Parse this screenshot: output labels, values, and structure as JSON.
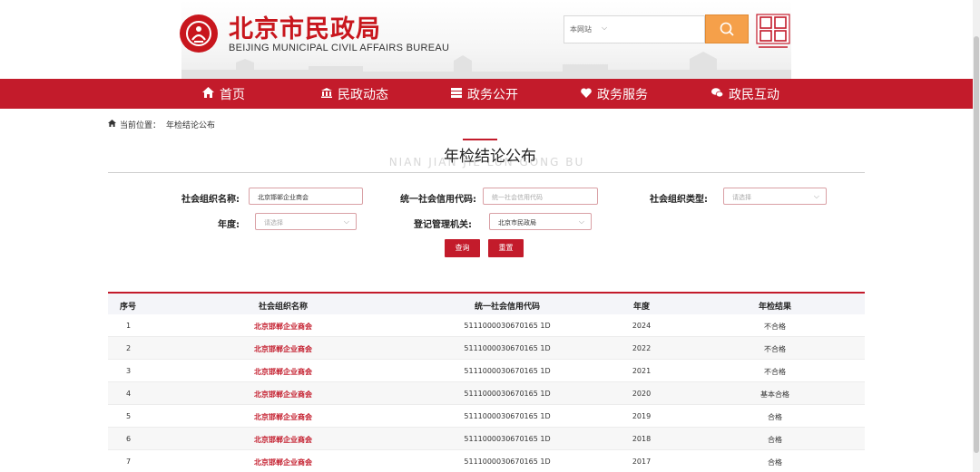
{
  "header": {
    "title_cn": "北京市民政局",
    "title_en": "BEIJING MUNICIPAL CIVIL AFFAIRS BUREAU",
    "search_scope": "本网站",
    "capital_logo_icon": "beijing-capital-logo"
  },
  "nav": {
    "items": [
      {
        "label": "首页",
        "icon": "home-icon"
      },
      {
        "label": "民政动态",
        "icon": "building-icon"
      },
      {
        "label": "政务公开",
        "icon": "list-icon"
      },
      {
        "label": "政务服务",
        "icon": "heart-icon"
      },
      {
        "label": "政民互动",
        "icon": "chat-icon"
      }
    ]
  },
  "breadcrumb": {
    "prefix": "当前位置：",
    "current": "年检结论公布"
  },
  "page": {
    "title": "年检结论公布",
    "title_en": "NIAN JIAN JIE LUN GONG BU"
  },
  "form": {
    "org_name_label": "社会组织名称:",
    "org_name_value": "北京邯郸企业商会",
    "credit_code_label": "统一社会信用代码:",
    "credit_code_placeholder": "统一社会信用代码",
    "org_type_label": "社会组织类型:",
    "org_type_placeholder": "请选择",
    "year_label": "年度:",
    "year_placeholder": "请选择",
    "registry_label": "登记管理机关:",
    "registry_value": "北京市民政局",
    "query_button": "查询",
    "reset_button": "重置"
  },
  "table": {
    "headers": [
      "序号",
      "社会组织名称",
      "统一社会信用代码",
      "年度",
      "年检结果"
    ],
    "rows": [
      {
        "no": "1",
        "name": "北京邯郸企业商会",
        "code": "5111000030670165 1D",
        "year": "2024",
        "result": "不合格"
      },
      {
        "no": "2",
        "name": "北京邯郸企业商会",
        "code": "5111000030670165 1D",
        "year": "2022",
        "result": "不合格"
      },
      {
        "no": "3",
        "name": "北京邯郸企业商会",
        "code": "5111000030670165 1D",
        "year": "2021",
        "result": "不合格"
      },
      {
        "no": "4",
        "name": "北京邯郸企业商会",
        "code": "5111000030670165 1D",
        "year": "2020",
        "result": "基本合格"
      },
      {
        "no": "5",
        "name": "北京邯郸企业商会",
        "code": "5111000030670165 1D",
        "year": "2019",
        "result": "合格"
      },
      {
        "no": "6",
        "name": "北京邯郸企业商会",
        "code": "5111000030670165 1D",
        "year": "2018",
        "result": "合格"
      },
      {
        "no": "7",
        "name": "北京邯郸企业商会",
        "code": "5111000030670165 1D",
        "year": "2017",
        "result": "合格"
      }
    ]
  },
  "colors": {
    "brand_red": "#c31b2b",
    "search_orange": "#f5a04a"
  }
}
